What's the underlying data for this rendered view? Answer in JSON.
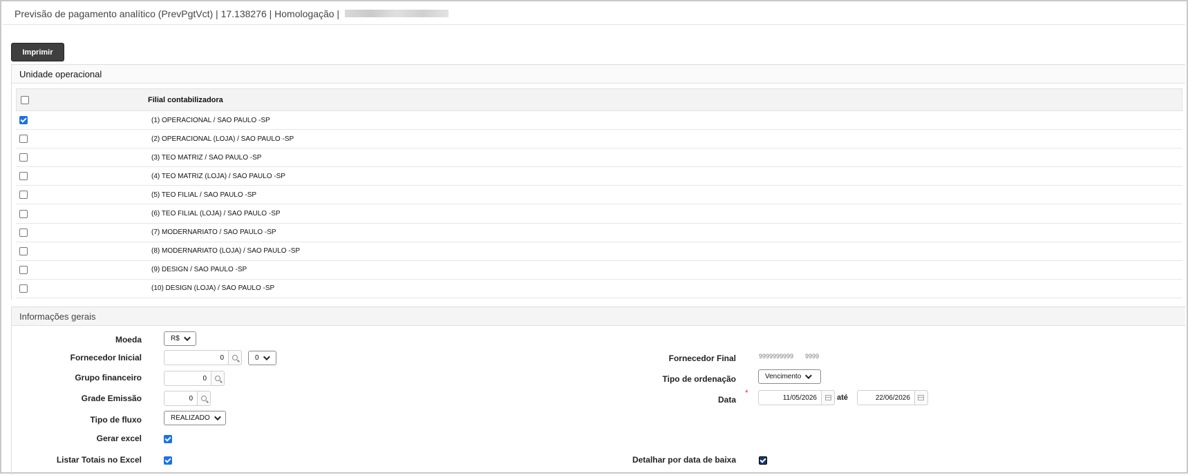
{
  "window": {
    "title": "Previsão de pagamento analítico (PrevPgtVct) | 17.138276 | Homologação |"
  },
  "toolbar": {
    "print_label": "Imprimir"
  },
  "unidade_operacional": {
    "title": "Unidade operacional",
    "column_header": "Filial contabilizadora",
    "rows": [
      {
        "label": "(1) OPERACIONAL / SAO PAULO -SP",
        "checked": true
      },
      {
        "label": "(2) OPERACIONAL (LOJA) / SAO PAULO -SP",
        "checked": false
      },
      {
        "label": "(3) TEO MATRIZ / SAO PAULO -SP",
        "checked": false
      },
      {
        "label": "(4) TEO MATRIZ (LOJA) / SAO PAULO -SP",
        "checked": false
      },
      {
        "label": "(5) TEO FILIAL / SAO PAULO -SP",
        "checked": false
      },
      {
        "label": "(6) TEO FILIAL (LOJA) / SAO PAULO -SP",
        "checked": false
      },
      {
        "label": "(7) MODERNARIATO / SAO PAULO -SP",
        "checked": false
      },
      {
        "label": "(8) MODERNARIATO (LOJA) / SAO PAULO -SP",
        "checked": false
      },
      {
        "label": "(9) DESIGN / SAO PAULO -SP",
        "checked": false
      },
      {
        "label": "(10) DESIGN (LOJA) / SAO PAULO -SP",
        "checked": false
      }
    ]
  },
  "informacoes_gerais": {
    "title": "Informações gerais",
    "moeda": {
      "label": "Moeda",
      "value": "R$"
    },
    "fornecedor_inicial": {
      "label": "Fornecedor Inicial",
      "value": "0",
      "select_value": "0"
    },
    "fornecedor_final": {
      "label": "Fornecedor Final",
      "value": "9999999999",
      "value2": "9999"
    },
    "grupo_financeiro": {
      "label": "Grupo financeiro",
      "value": "0"
    },
    "tipo_ordenacao": {
      "label": "Tipo de ordenação",
      "value": "Vencimento"
    },
    "grade_emissao": {
      "label": "Grade Emissão",
      "value": "0"
    },
    "data": {
      "label": "Data",
      "required_mark": "*",
      "from": "11/05/2026",
      "until_label": "até",
      "to": "22/06/2026"
    },
    "tipo_fluxo": {
      "label": "Tipo de fluxo",
      "value": "REALIZADO"
    },
    "gerar_excel": {
      "label": "Gerar excel",
      "checked": true
    },
    "listar_totais": {
      "label": "Listar Totais no Excel",
      "checked": true
    },
    "detalhar_baixa": {
      "label": "Detalhar por data de baixa",
      "checked": true
    }
  }
}
